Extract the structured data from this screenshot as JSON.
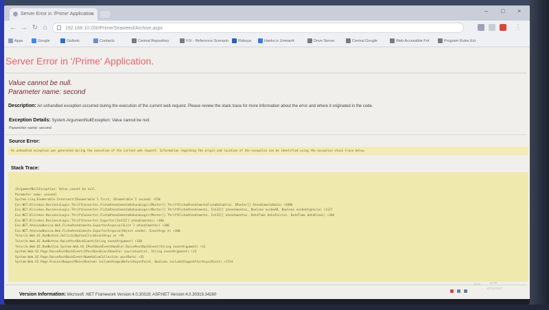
{
  "browser": {
    "tab_title": "Server Error in '/Prime' Application",
    "url": "192.168.10.200/Prime/Seaweed/Archive.aspx",
    "window_controls": [
      "–",
      "□",
      "×"
    ],
    "bookmarks": [
      {
        "label": "Apps",
        "color": "#8fa0c8"
      },
      {
        "label": "Google",
        "color": "#4285f4"
      },
      {
        "label": "Outlook",
        "color": "#2a6fc9"
      },
      {
        "label": "Contacts",
        "color": "#6a8fd0"
      },
      {
        "label": "Central Repository",
        "color": "#7a7a7a"
      },
      {
        "label": "FIX - Reference Scenario",
        "color": "#7a7a7a"
      },
      {
        "label": "Roboya",
        "color": "#2d5fb8"
      },
      {
        "label": "Hanks is Unmarrit",
        "color": "#3a7bd5"
      },
      {
        "label": "Drive Server",
        "color": "#7a7a7a"
      },
      {
        "label": "Central Google",
        "color": "#7a7a7a"
      },
      {
        "label": "Web Accessible Fnt",
        "color": "#7a7a7a"
      },
      {
        "label": "Program Rules Ext",
        "color": "#7a7a7a"
      }
    ]
  },
  "error": {
    "title": "Server Error in '/Prime' Application.",
    "message_line1": "Value cannot be null.",
    "message_line2": "Parameter name: second",
    "description_label": "Description:",
    "description_text": "An unhandled exception occurred during the execution of the current web request. Please review the stack trace for more information about the error and where it originated in the code.",
    "exception_label": "Exception Details:",
    "exception_text": "System.ArgumentNullException: Value cannot be null.",
    "parameter_line": "Parameter name: second",
    "source_error_label": "Source Error:",
    "source_error_text": "An unhandled exception was generated during the execution of the current web request. Information regarding the origin and location of the exception can be identified using the exception stack trace below.",
    "stack_trace_label": "Stack Trace:",
    "stack_trace": [
      "[ArgumentNullException: Value cannot be null.",
      "Parameter name: second]",
      "   System.Linq.Enumerable.Intersect(IEnumerable`1 first, IEnumerable`1 second) +150",
      "   Eco.NET.Klinikos.BusinessLogic.ThriftConverter.FichaAtendimentoKahunaLogic(Master[] ThriftFichaAtendimentoFichaDataGrid, IMaster[] AtendimentoData) +2088",
      "   Eco.NET.Klinikos.BusinessLogic.ThriftConverter.FichaAtendimentoKahunaLogic(Master[] ThriftFichaAtendimento, Int32[] atendimentos, Boolean exibeAB, Boolean exibeUrgencia) +1127",
      "   Eco.NET.Klinikos.BusinessLogic.ThriftConverter.FichaAtendimentoKahunaLogic(Master[] ThriftFichaAtendimento, Int32[] atendimentos, DateTime dataInicial, DateTime dataFinal) +304",
      "   Eco.NET.Klinikos.BusinessLogic.ThriftConverter.Exportar(Int32[] atendimentos) +368",
      "   Eco.NET.AtencaoBasica.Web.FichaAtendimento.ExportarArquivo(IList`1 atendimentos) +108",
      "   Eco.NET.AtencaoBasica.Web.FichaAtendimento.ExportarArquivo(Object sender, EventArgs e) +100",
      "   Telerik.Web.UI.RadButton.OnClick(ButtonClickEventArgs e) +95",
      "   Telerik.Web.UI.RadButton.RaisePostBackEvent(String eventArgument) +168",
      "   Telerik.Web.UI.RadButton.System.Web.UI.IPostBackEventHandler.RaisePostBackEvent(String eventArgument) +12",
      "   System.Web.UI.Page.RaisePostBackEvent(IPostBackEventHandler sourceControl, String eventArgument) +13",
      "   System.Web.UI.Page.RaisePostBackEvent(NameValueCollection postData) +35",
      "   System.Web.UI.Page.ProcessRequestMain(Boolean includeStagesBeforeAsyncPoint, Boolean includeStagesAfterAsyncPoint) +1724"
    ],
    "version_label": "Version Information:",
    "version_text": "Microsoft .NET Framework Version:4.0.30319; ASP.NET Version:4.0.30319.34280"
  },
  "tray": {
    "lang": "POR",
    "time": "11:00",
    "date": "07/11/2017"
  },
  "colors": {
    "error_title": "#e8626a",
    "error_message": "#7b2a2f",
    "stack_background": "#f0e9ad"
  }
}
